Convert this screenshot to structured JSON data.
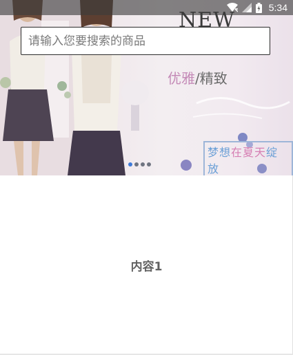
{
  "status_bar": {
    "time": "5:34",
    "icons": [
      "wifi-icon",
      "cell-signal-icon",
      "battery-icon"
    ]
  },
  "search": {
    "placeholder": "请输入您要搜索的商品",
    "value": ""
  },
  "banner": {
    "headline": "NEW",
    "line1": "",
    "line2_accent": "优雅",
    "line2_rest": "/精致",
    "tagline_a": "梦想",
    "tagline_accent": "在夏天",
    "tagline_b": "绽放",
    "slide_count": 4,
    "active_slide": 1
  },
  "content": {
    "label": "内容1"
  },
  "colors": {
    "accent_dot": "#3f7ad8",
    "text_gray": "#616161"
  }
}
